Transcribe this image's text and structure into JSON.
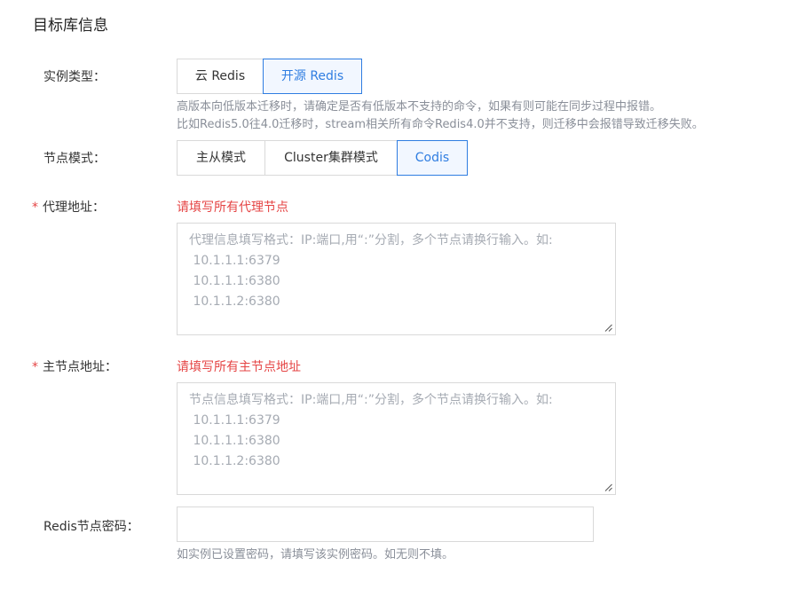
{
  "section_title": "目标库信息",
  "instance_type": {
    "label": "实例类型：",
    "options": [
      "云 Redis",
      "开源 Redis"
    ],
    "selected": "开源 Redis",
    "hint_line1": "高版本向低版本迁移时，请确定是否有低版本不支持的命令，如果有则可能在同步过程中报错。",
    "hint_line2": "比如Redis5.0往4.0迁移时，stream相关所有命令Redis4.0并不支持，则迁移中会报错导致迁移失败。"
  },
  "node_mode": {
    "label": "节点模式：",
    "options": [
      "主从模式",
      "Cluster集群模式",
      "Codis"
    ],
    "selected": "Codis"
  },
  "proxy_address": {
    "required_mark": "*",
    "label": "代理地址：",
    "error": "请填写所有代理节点",
    "placeholder": "代理信息填写格式：IP:端口,用“:”分割，多个节点请换行输入。如:\n 10.1.1.1:6379\n 10.1.1.1:6380\n 10.1.1.2:6380"
  },
  "master_address": {
    "required_mark": "*",
    "label": "主节点地址：",
    "error": "请填写所有主节点地址",
    "placeholder": "节点信息填写格式：IP:端口,用“:”分割，多个节点请换行输入。如:\n 10.1.1.1:6379\n 10.1.1.1:6380\n 10.1.1.2:6380"
  },
  "redis_password": {
    "label": "Redis节点密码：",
    "value": "",
    "hint": "如实例已设置密码，请填写该实例密码。如无则不填。"
  },
  "colors": {
    "accent": "#2f7de1",
    "error": "#e54545",
    "hint": "#8a8f99",
    "border": "#d9d9d9"
  }
}
